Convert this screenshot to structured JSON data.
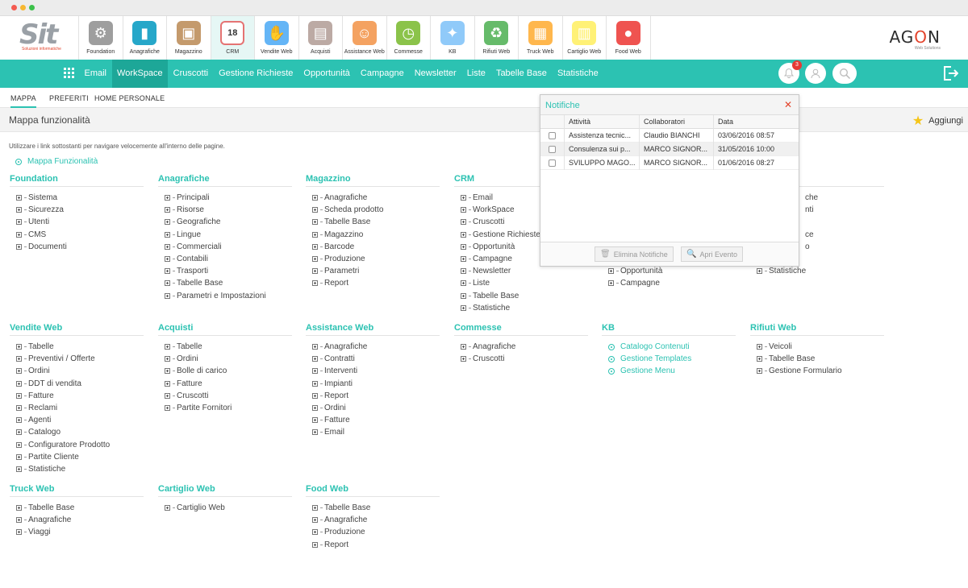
{
  "window": {
    "title": ""
  },
  "brand": {
    "logo_text": "Sit",
    "logo_sub": "Soluzioni informatiche",
    "partner": "AGON",
    "partner_sub": "Web Solutions"
  },
  "modules": [
    {
      "label": "Foundation",
      "icon": "gear-icon",
      "color": "#9e9e9e"
    },
    {
      "label": "Anagrafiche",
      "icon": "book-icon",
      "color": "#26a7c9"
    },
    {
      "label": "Magazzino",
      "icon": "box-icon",
      "color": "#c49a6c"
    },
    {
      "label": "CRM",
      "icon": "calendar-icon",
      "color": "#e57373",
      "active": true
    },
    {
      "label": "Vendite Web",
      "icon": "handshake-icon",
      "color": "#64b5f6"
    },
    {
      "label": "Acquisti",
      "icon": "clipboard-icon",
      "color": "#bcaaa4"
    },
    {
      "label": "Assistance Web",
      "icon": "headset-icon",
      "color": "#f4a261"
    },
    {
      "label": "Commesse",
      "icon": "clock-money-icon",
      "color": "#8bc34a"
    },
    {
      "label": "KB",
      "icon": "knowledge-icon",
      "color": "#90caf9"
    },
    {
      "label": "Rifiuti Web",
      "icon": "recycle-icon",
      "color": "#66bb6a"
    },
    {
      "label": "Truck Web",
      "icon": "truck-box-icon",
      "color": "#ffb74d"
    },
    {
      "label": "Cartiglio Web",
      "icon": "document-icon",
      "color": "#fff176"
    },
    {
      "label": "Food Web",
      "icon": "fruit-icon",
      "color": "#ef5350"
    }
  ],
  "nav": [
    {
      "label": "Email"
    },
    {
      "label": "WorkSpace",
      "active": true
    },
    {
      "label": "Cruscotti"
    },
    {
      "label": "Gestione Richieste"
    },
    {
      "label": "Opportunità"
    },
    {
      "label": "Campagne"
    },
    {
      "label": "Newsletter"
    },
    {
      "label": "Liste"
    },
    {
      "label": "Tabelle Base"
    },
    {
      "label": "Statistiche"
    }
  ],
  "notifications_count": "3",
  "tabs": [
    {
      "label": "MAPPA",
      "active": true
    },
    {
      "label": "PREFERITI"
    },
    {
      "label": "HOME PERSONALE"
    }
  ],
  "page": {
    "title": "Mappa funzionalità",
    "add_label": "Aggiungi",
    "intro": "Utilizzare i link sottostanti per navigare velocemente all'interno delle pagine.",
    "map_link": "Mappa Funzionalità"
  },
  "sections": [
    {
      "title": "Foundation",
      "items": [
        "Sistema",
        "Sicurezza",
        "Utenti",
        "CMS",
        "Documenti"
      ]
    },
    {
      "title": "Anagrafiche",
      "items": [
        "Principali",
        "Risorse",
        "Geografiche",
        "Lingue",
        "Commerciali",
        "Contabili",
        "Trasporti",
        "Tabelle Base",
        "Parametri e Impostazioni"
      ]
    },
    {
      "title": "Magazzino",
      "items": [
        "Anagrafiche",
        "Scheda prodotto",
        "Tabelle Base",
        "Magazzino",
        "Barcode",
        "Produzione",
        "Parametri",
        "Report"
      ]
    },
    {
      "title": "CRM",
      "items": [
        "Email",
        "WorkSpace",
        "Cruscotti",
        "Gestione Richieste",
        "Opportunità",
        "Campagne",
        "Newsletter",
        "Liste",
        "Tabelle Base",
        "Statistiche"
      ]
    },
    {
      "title": "",
      "items": [
        "",
        "",
        "",
        "",
        "",
        "",
        "Opportunità",
        "Campagne"
      ]
    },
    {
      "title": "e",
      "items": [
        "che",
        "nti",
        "",
        "ce",
        "o",
        "",
        "Statistiche"
      ]
    },
    {
      "title": "Vendite Web",
      "items": [
        "Tabelle",
        "Preventivi / Offerte",
        "Ordini",
        "DDT di vendita",
        "Fatture",
        "Reclami",
        "Agenti",
        "Catalogo",
        "Configuratore Prodotto",
        "Partite Cliente",
        "Statistiche"
      ]
    },
    {
      "title": "Acquisti",
      "items": [
        "Tabelle",
        "Ordini",
        "Bolle di carico",
        "Fatture",
        "Cruscotti",
        "Partite Fornitori"
      ]
    },
    {
      "title": "Assistance Web",
      "items": [
        "Anagrafiche",
        "Contratti",
        "Interventi",
        "Impianti",
        "Report",
        "Ordini",
        "Fatture",
        "Email"
      ]
    },
    {
      "title": "Commesse",
      "items": [
        "Anagrafiche",
        "Cruscotti"
      ]
    },
    {
      "title": "KB",
      "items": [
        "Catalogo Contenuti",
        "Gestione Templates",
        "Gestione Menu"
      ],
      "green": true
    },
    {
      "title": "Rifiuti Web",
      "items": [
        "Veicoli",
        "Tabelle Base",
        "Gestione Formulario"
      ]
    },
    {
      "title": "Truck Web",
      "items": [
        "Tabelle Base",
        "Anagrafiche",
        "Viaggi"
      ]
    },
    {
      "title": "Cartiglio Web",
      "items": [
        "Cartiglio Web"
      ]
    },
    {
      "title": "Food Web",
      "items": [
        "Tabelle Base",
        "Anagrafiche",
        "Produzione",
        "Report"
      ]
    }
  ],
  "popup": {
    "title": "Notifiche",
    "columns": [
      "Attività",
      "Collaboratori",
      "Data"
    ],
    "rows": [
      [
        "Assistenza tecnic...",
        "Claudio BIANCHI",
        "03/06/2016 08:57"
      ],
      [
        "Consulenza sui p...",
        "MARCO SIGNOR...",
        "31/05/2016 10:00"
      ],
      [
        "SVILUPPO MAGO...",
        "MARCO SIGNOR...",
        "01/06/2016 08:27"
      ]
    ],
    "delete_label": "Elimina Notifiche",
    "open_label": "Apri Evento"
  }
}
